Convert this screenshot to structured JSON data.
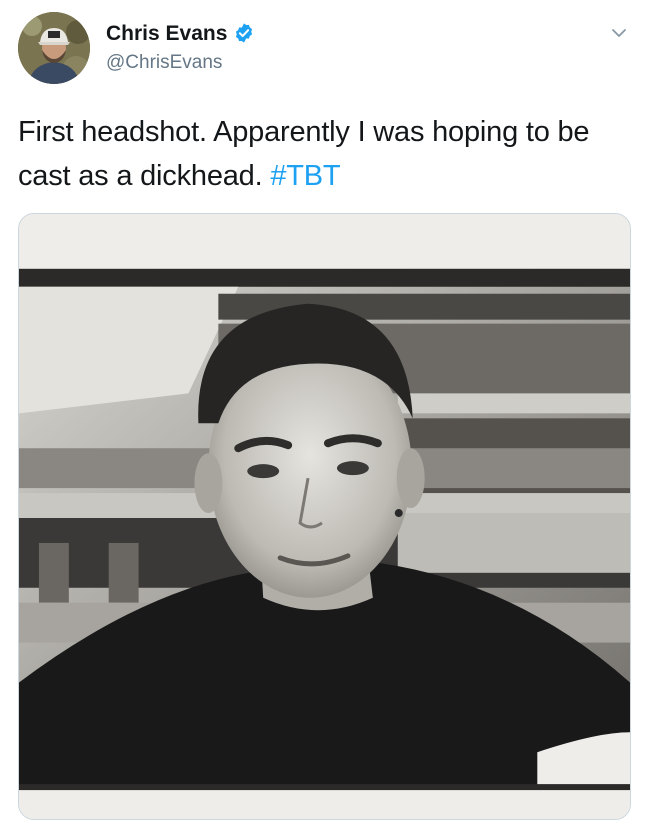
{
  "tweet": {
    "author": {
      "display_name": "Chris Evans",
      "handle": "@ChrisEvans",
      "verified": true
    },
    "text": {
      "body": "First headshot. Apparently I was hoping to be cast as a dickhead.",
      "hashtag": "#TBT"
    },
    "colors": {
      "name": "#14171a",
      "handle": "#657786",
      "hashtag": "#1da1f2",
      "verified_badge": "#1da1f2"
    },
    "icons": {
      "verified": "verified-badge-icon",
      "menu": "chevron-down-icon"
    }
  }
}
